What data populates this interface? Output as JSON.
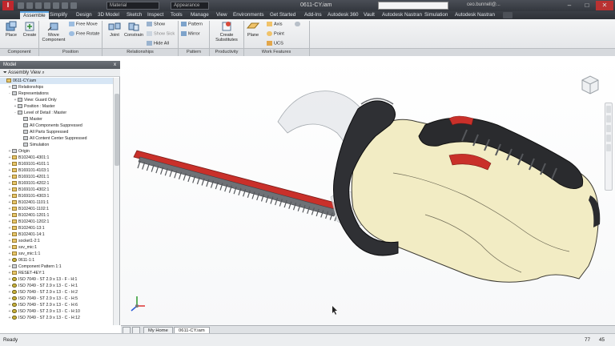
{
  "titlebar": {
    "app_icon": "I",
    "material": "Material",
    "appearance": "Appearance",
    "doc_title": "0611-CY.iam",
    "user": "ceo.bunnell@...",
    "help": "?",
    "minimize": "–",
    "maximize": "□",
    "close": "✕"
  },
  "tabs": [
    "Assemble",
    "Simplify",
    "Design",
    "3D Model",
    "Sketch",
    "Inspect",
    "Tools",
    "Manage",
    "View",
    "Environments",
    "Get Started",
    "Add-Ins",
    "Autodesk 360",
    "Vault",
    "Autodesk Nastran",
    "Simulation",
    "Autodesk Nastran"
  ],
  "ribbon": {
    "place": "Place",
    "create": "Create",
    "move_component": [
      "Move",
      "Component"
    ],
    "free_move": "Free Move",
    "free_rotate": "Free Rotate",
    "joint": "Joint",
    "constrain": "Constrain",
    "show": "Show",
    "show_sick": "Show Sick",
    "hide_all": "Hide All",
    "pattern": "Pattern",
    "mirror": "Mirror",
    "create_substitutes": [
      "Create",
      "Substitutes"
    ],
    "plane": "Plane",
    "axis": "Axis",
    "point": "Point",
    "ucs": "UCS"
  },
  "panels": [
    "Component",
    "Position",
    "Relationships",
    "Pattern",
    "Productivity",
    "Work Features"
  ],
  "browser": {
    "title": "Model",
    "close": "x",
    "view": "Assembly View",
    "items": [
      {
        "t": "0611-CY.iam",
        "lvl": 0,
        "icon": "asm",
        "sel": true,
        "exp": ""
      },
      {
        "t": "Relationships",
        "lvl": 1,
        "icon": "gray",
        "exp": "+"
      },
      {
        "t": "Representations",
        "lvl": 1,
        "icon": "gray",
        "exp": "-"
      },
      {
        "t": "View: Guard Only",
        "lvl": 2,
        "icon": "gray",
        "exp": "+"
      },
      {
        "t": "Position : Master",
        "lvl": 2,
        "icon": "gray",
        "exp": "+"
      },
      {
        "t": "Level of Detail : Master",
        "lvl": 2,
        "icon": "gray",
        "exp": "-"
      },
      {
        "t": "Master",
        "lvl": 3,
        "icon": "gray",
        "exp": ""
      },
      {
        "t": "All Components Suppressed",
        "lvl": 3,
        "icon": "gray",
        "exp": ""
      },
      {
        "t": "All Parts Suppressed",
        "lvl": 3,
        "icon": "gray",
        "exp": ""
      },
      {
        "t": "All Content Center Suppressed",
        "lvl": 3,
        "icon": "gray",
        "exp": ""
      },
      {
        "t": "Simulation",
        "lvl": 3,
        "icon": "gray",
        "exp": ""
      },
      {
        "t": "Origin",
        "lvl": 1,
        "icon": "gray",
        "exp": "+"
      },
      {
        "t": "B102401-4301:1",
        "lvl": 1,
        "icon": "part",
        "exp": "+"
      },
      {
        "t": "B169101-4101:1",
        "lvl": 1,
        "icon": "part",
        "exp": "+"
      },
      {
        "t": "B169101-4103:1",
        "lvl": 1,
        "icon": "part",
        "exp": "+"
      },
      {
        "t": "B169101-4201:1",
        "lvl": 1,
        "icon": "part",
        "exp": "+"
      },
      {
        "t": "B169101-4202:1",
        "lvl": 1,
        "icon": "part",
        "exp": "+"
      },
      {
        "t": "B169101-4302:1",
        "lvl": 1,
        "icon": "part",
        "exp": "+"
      },
      {
        "t": "B169101-4303:1",
        "lvl": 1,
        "icon": "part",
        "exp": "+"
      },
      {
        "t": "B102401-1101:1",
        "lvl": 1,
        "icon": "part",
        "exp": "+"
      },
      {
        "t": "B102401-1102:1",
        "lvl": 1,
        "icon": "part",
        "exp": "+"
      },
      {
        "t": "B102401-1201:1",
        "lvl": 1,
        "icon": "part",
        "exp": "+"
      },
      {
        "t": "B102401-1202:1",
        "lvl": 1,
        "icon": "part",
        "exp": "+"
      },
      {
        "t": "B102401-13:1",
        "lvl": 1,
        "icon": "part",
        "exp": "+"
      },
      {
        "t": "B102401-14:1",
        "lvl": 1,
        "icon": "part",
        "exp": "+"
      },
      {
        "t": "socket1-2:1",
        "lvl": 1,
        "icon": "part",
        "exp": "+"
      },
      {
        "t": "ssv_mic:1",
        "lvl": 1,
        "icon": "part",
        "exp": "+"
      },
      {
        "t": "ssv_mic:1:1",
        "lvl": 1,
        "icon": "part",
        "exp": "+"
      },
      {
        "t": "0611-1:1",
        "lvl": 1,
        "icon": "yel",
        "exp": "+"
      },
      {
        "t": "Component Pattern 1:1",
        "lvl": 1,
        "icon": "gray",
        "exp": "+"
      },
      {
        "t": "RESET-4EY:1",
        "lvl": 1,
        "icon": "part",
        "exp": "+"
      },
      {
        "t": "ISO 7049 - ST 2.9 x 13 - F - H:1",
        "lvl": 1,
        "icon": "yel",
        "exp": "+"
      },
      {
        "t": "ISO 7049 - ST 2.9 x 13 - C - H:1",
        "lvl": 1,
        "icon": "yel",
        "exp": "+"
      },
      {
        "t": "ISO 7049 - ST 2.9 x 13 - C - H:2",
        "lvl": 1,
        "icon": "yel",
        "exp": "+"
      },
      {
        "t": "ISO 7049 - ST 2.9 x 13 - C - H:5",
        "lvl": 1,
        "icon": "yel",
        "exp": "+"
      },
      {
        "t": "ISO 7049 - ST 2.9 x 13 - C - H:6",
        "lvl": 1,
        "icon": "yel",
        "exp": "+"
      },
      {
        "t": "ISO 7049 - ST 2.9 x 13 - C - H:10",
        "lvl": 1,
        "icon": "yel",
        "exp": "+"
      },
      {
        "t": "ISO 7049 - ST 2.9 x 13 - C - H:12",
        "lvl": 1,
        "icon": "yel",
        "exp": "+"
      }
    ]
  },
  "viewcube": {
    "face": "RIGHT"
  },
  "doc_tabs": [
    "My Home",
    "0611-CY.iam"
  ],
  "status": {
    "left": "Ready",
    "right1": "77",
    "right2": "45"
  },
  "colors": {
    "accent": "#5da6e4",
    "body": "#f2ecc4",
    "blade": "#d8372e",
    "handle": "#2a2b2e"
  }
}
